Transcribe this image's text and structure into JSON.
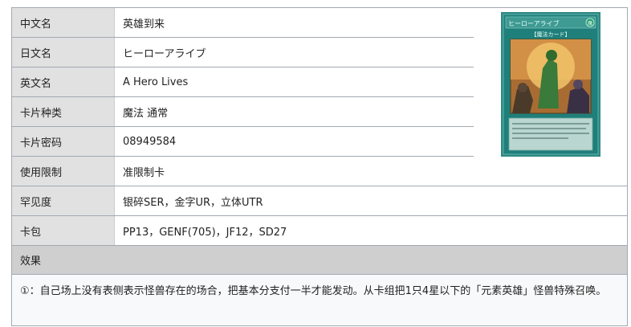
{
  "rows": [
    {
      "label": "中文名",
      "value": "英雄到来"
    },
    {
      "label": "日文名",
      "value": "ヒーローアライブ"
    },
    {
      "label": "英文名",
      "value": "A Hero Lives"
    },
    {
      "label": "卡片种类",
      "value": "魔法 通常"
    },
    {
      "label": "卡片密码",
      "value": "08949584"
    },
    {
      "label": "使用限制",
      "value": "准限制卡"
    },
    {
      "label": "罕见度",
      "value": "银碎SER，金字UR，立体UTR"
    },
    {
      "label": "卡包",
      "value": "PP13，GENF(705)，JF12，SD27"
    }
  ],
  "effect": {
    "heading": "效果",
    "text": "①：自己场上没有表侧表示怪兽存在的场合，把基本分支付一半才能发动。从卡组把1只4星以下的「元素英雄」怪兽特殊召唤。"
  },
  "card_image": {
    "name_text": "ヒーローアライブ",
    "type_text": "【魔法カード】",
    "attribute_icon": "spell-attribute-icon",
    "frame_color": "#1f7f7a"
  }
}
